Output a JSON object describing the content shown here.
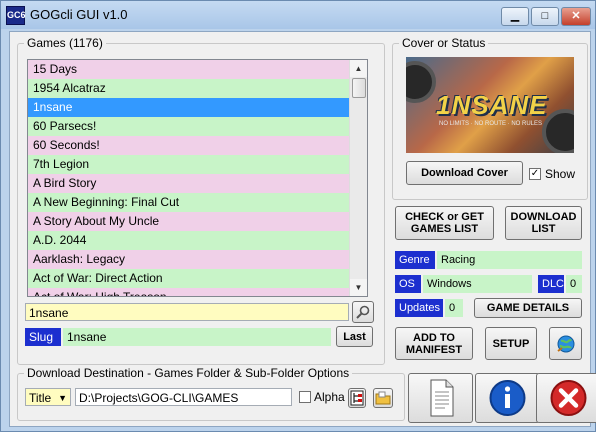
{
  "window": {
    "title": "GOGcli GUI v1.0",
    "app_icon_text": "GC6",
    "minimize_glyph": "▁",
    "maximize_glyph": "□",
    "close_glyph": "✕"
  },
  "games": {
    "legend": "Games  (1176)",
    "items": [
      "15 Days",
      "1954 Alcatraz",
      "1nsane",
      "60 Parsecs!",
      "60 Seconds!",
      "7th Legion",
      "A Bird Story",
      "A New Beginning: Final Cut",
      "A Story About My Uncle",
      "A.D. 2044",
      "Aarklash: Legacy",
      "Act of War: Direct Action",
      "Act of War: High Treason"
    ],
    "selected_index": 2,
    "search_value": "1nsane",
    "slug_label": "Slug",
    "slug_value": "1nsane",
    "last_button": "Last"
  },
  "cover": {
    "legend": "Cover or Status",
    "logo_text": "1NSANE",
    "logo_tagline": "NO LIMITS · NO ROUTE · NO RULES",
    "download_cover_button": "Download Cover",
    "show_label": "Show",
    "show_checked": true
  },
  "actions": {
    "check_or_get": "CHECK or GET GAMES LIST",
    "download_list": "DOWNLOAD LIST",
    "game_details": "GAME DETAILS",
    "add_to_manifest": "ADD TO MANIFEST",
    "setup": "SETUP"
  },
  "info": {
    "genre_label": "Genre",
    "genre_value": "Racing",
    "os_label": "OS",
    "os_value": "Windows",
    "dlc_label": "DLC",
    "dlc_value": "0",
    "updates_label": "Updates",
    "updates_value": "0"
  },
  "download_dest": {
    "legend": "Download Destination - Games Folder & Sub-Folder Options",
    "mode_selected": "Title",
    "path_value": "D:\\Projects\\GOG-CLI\\GAMES",
    "alpha_label": "Alpha",
    "alpha_checked": false
  },
  "colors": {
    "row_pink": "#f0d0e8",
    "row_green": "#c8f4c8",
    "selection": "#3399ff",
    "label_blue": "#1c2fcf"
  }
}
